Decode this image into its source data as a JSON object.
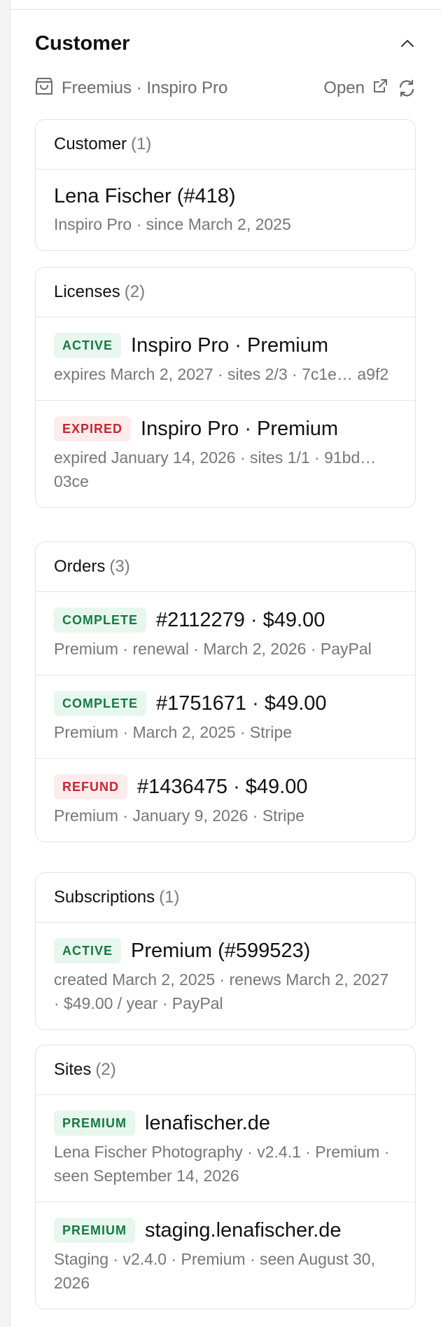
{
  "section": {
    "title": "Customer",
    "source": "Freemius · Inspiro Pro",
    "open_label": "Open"
  },
  "customer_card": {
    "heading": "Customer",
    "count": "(1)",
    "name": "Lena Fischer (#418)",
    "sub": "Inspiro Pro · since March 2, 2025"
  },
  "licenses_card": {
    "heading": "Licenses",
    "count": "(2)",
    "items": [
      {
        "badge": "ACTIVE",
        "badge_color": "#167a45",
        "title": "Inspiro Pro · Premium",
        "sub": "expires March 2, 2027 · sites 2/3 · 7c1e… a9f2"
      },
      {
        "badge": "EXPIRED",
        "badge_color": "#c4262e",
        "title": "Inspiro Pro · Premium",
        "sub": "expired January 14, 2026 · sites 1/1 · 91bd…03ce"
      }
    ]
  },
  "orders_card": {
    "heading": "Orders",
    "count": "(3)",
    "items": [
      {
        "badge": "COMPLETE",
        "title": "#2112279 · $49.00",
        "sub": "Premium · renewal · March 2, 2026 · PayPal"
      },
      {
        "badge": "COMPLETE",
        "title": "#1751671 · $49.00",
        "sub": "Premium · March 2, 2025 · Stripe"
      },
      {
        "badge": "REFUND",
        "title": "#1436475 · $49.00",
        "sub": "Premium · January 9, 2026 · Stripe"
      }
    ]
  },
  "subscriptions_card": {
    "heading": "Subscriptions",
    "count": "(1)",
    "items": [
      {
        "badge": "ACTIVE",
        "title": "Premium (#599523)",
        "sub": "created March 2, 2025 · renews March 2, 2027 · $49.00 / year · PayPal"
      }
    ]
  },
  "sites_card": {
    "heading": "Sites",
    "count": "(2)",
    "items": [
      {
        "badge": "PREMIUM",
        "title": "lenafischer.de",
        "sub": "Lena Fischer Photography · v2.4.1 · Premium · seen September 14, 2026"
      },
      {
        "badge": "PREMIUM",
        "title": "staging.lenafischer.de",
        "sub": "Staging · v2.4.0 · Premium · seen August 30, 2026"
      }
    ]
  },
  "colors": {
    "success": "#167a45",
    "danger": "#c4262e"
  }
}
